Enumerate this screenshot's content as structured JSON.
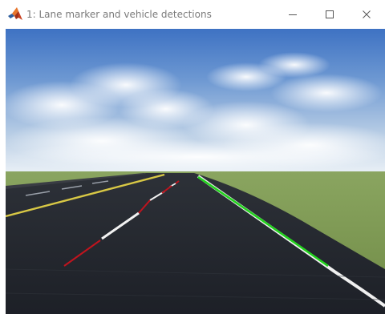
{
  "window": {
    "title": "1: Lane marker and vehicle detections",
    "app_icon": "matlab-icon",
    "controls": {
      "minimize_icon": "minimize-icon",
      "maximize_icon": "maximize-icon",
      "close_icon": "close-icon"
    }
  },
  "scene": {
    "description_icon": "road-scene",
    "colors": {
      "sky_top": "#3f73c4",
      "sky_horizon": "#e6eef5",
      "grass": "#7f9a52",
      "road": "#22262d",
      "left_lane_detection": "#c0141e",
      "right_lane_detection": "#23d21e",
      "yellow_edge_line": "#d8c845",
      "white_marking": "#f2f2f2"
    }
  }
}
